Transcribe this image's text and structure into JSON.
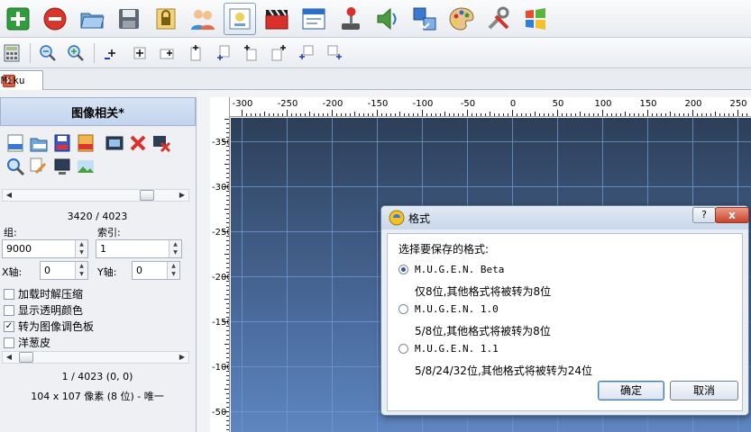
{
  "tabs": [
    {
      "label": "Miku",
      "close": "x"
    }
  ],
  "panel": {
    "title": "图像相关*",
    "counter": "3420 / 4023",
    "group_label": "组:",
    "group_value": "9000",
    "index_label": "索引:",
    "index_value": "1",
    "x_label": "X轴:",
    "x_value": "0",
    "y_label": "Y轴:",
    "y_value": "0",
    "options": [
      {
        "label": "加载时解压缩",
        "checked": false
      },
      {
        "label": "显示透明颜色",
        "checked": false
      },
      {
        "label": "转为图像调色板",
        "checked": true
      },
      {
        "label": "洋葱皮",
        "checked": false
      }
    ],
    "check_mark": "✓",
    "frame_info": "1 / 4023 (0, 0)",
    "size_info": "104 x 107 像素 (8 位) - 唯一"
  },
  "ruler": {
    "top_labels": [
      "-300",
      "-250",
      "-200",
      "-150",
      "-100",
      "-50",
      "0",
      "50",
      "100",
      "150",
      "200",
      "250"
    ],
    "left_labels": [
      "-350",
      "-300",
      "-250",
      "-200",
      "-150",
      "-100",
      "-50"
    ]
  },
  "dialog": {
    "title": "格式",
    "help": "?",
    "close": "x",
    "prompt": "选择要保存的格式:",
    "options": [
      {
        "label": "M.U.G.E.N. Beta",
        "desc": "仅8位,其他格式将被转为8位",
        "selected": true
      },
      {
        "label": "M.U.G.E.N. 1.0",
        "desc": "5/8位,其他格式将被转为8位",
        "selected": false
      },
      {
        "label": "M.U.G.E.N. 1.1",
        "desc": "5/8/24/32位,其他格式将被转为24位",
        "selected": false
      }
    ],
    "ok": "确定",
    "cancel": "取消"
  },
  "colors": {
    "accent": "#3b77c6",
    "viewport_top": "#2d3f58",
    "viewport_bottom": "#5f86c0",
    "grid": "#6f9ad6"
  }
}
